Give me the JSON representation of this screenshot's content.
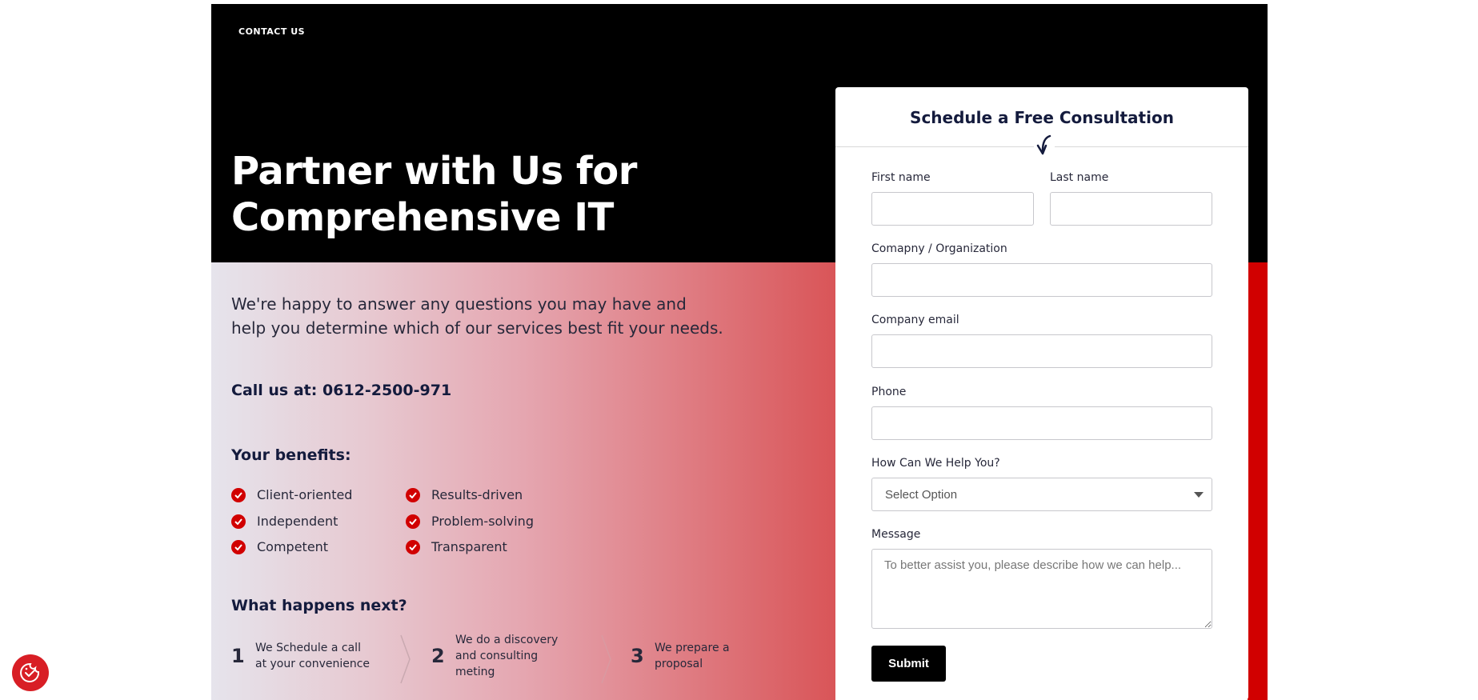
{
  "nav": {
    "contact_us": "CONTACT US"
  },
  "hero": {
    "title_line1": "Partner with Us for",
    "title_line2": "Comprehensive IT",
    "intro_line1": "We're happy to answer any questions you may have and",
    "intro_line2": "help you determine which of our services best fit your needs.",
    "call": "Call us at: 0612-2500-971"
  },
  "benefits": {
    "title": "Your benefits:",
    "items": [
      "Client-oriented",
      "Independent",
      "Competent",
      "Results-driven",
      "Problem-solving",
      "Transparent"
    ]
  },
  "next_steps": {
    "title": "What happens next?",
    "steps": [
      {
        "number": "1",
        "line1": "We Schedule a call",
        "line2": "at your convenience",
        "line3": ""
      },
      {
        "number": "2",
        "line1": "We do a discovery",
        "line2": "and consulting",
        "line3": "meting"
      },
      {
        "number": "3",
        "line1": "We prepare a",
        "line2": "proposal",
        "line3": ""
      }
    ]
  },
  "form": {
    "title": "Schedule a Free Consultation",
    "first_name_label": "First name",
    "first_name_value": "",
    "last_name_label": "Last name",
    "last_name_value": "",
    "company_label": "Comapny / Organization",
    "company_value": "",
    "email_label": "Company email",
    "email_value": "",
    "phone_label": "Phone",
    "phone_value": "",
    "help_label": "How Can We Help You?",
    "help_selected": "Select Option",
    "message_label": "Message",
    "message_placeholder": "To better assist you, please describe how we can help...",
    "submit_label": "Submit"
  },
  "colors": {
    "accent_red": "#d10000",
    "hero_black": "#000000",
    "navy_text": "#141b3d"
  },
  "icons": {
    "check": "check-circle-icon",
    "arrow": "curved-arrow-down-icon",
    "cookie": "cookie-consent-icon"
  }
}
